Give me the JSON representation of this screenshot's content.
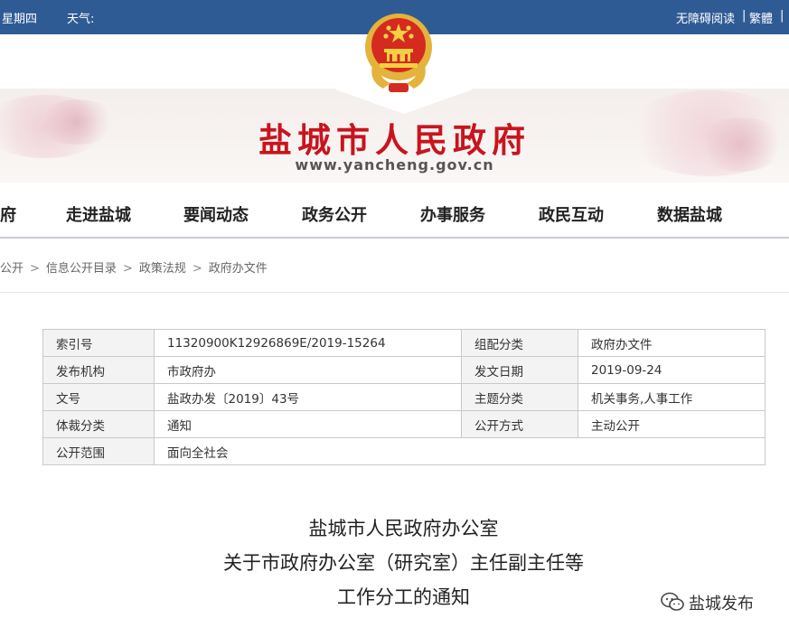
{
  "topbar": {
    "weekday": "星期四",
    "weather": "天气:",
    "accessibility": "无障碍阅读",
    "separator": "|",
    "traditional": "繁體"
  },
  "header": {
    "site_title": "盐城市人民政府",
    "url": "www.yancheng.gov.cn",
    "emblem_icon": "national-emblem-icon"
  },
  "nav": {
    "items": [
      "府",
      "走进盐城",
      "要闻动态",
      "政务公开",
      "办事服务",
      "政民互动",
      "数据盐城"
    ]
  },
  "breadcrumb": {
    "items": [
      "公开",
      "信息公开目录",
      "政策法规",
      "政府办文件"
    ],
    "separator": ">"
  },
  "meta_table": {
    "rows": [
      [
        "索引号",
        "11320900K12926869E/2019-15264",
        "组配分类",
        "政府办文件"
      ],
      [
        "发布机构",
        "市政府办",
        "发文日期",
        "2019-09-24"
      ],
      [
        "文号",
        "盐政办发〔2019〕43号",
        "主题分类",
        "机关事务,人事工作"
      ],
      [
        "体裁分类",
        "通知",
        "公开方式",
        "主动公开"
      ],
      [
        "公开范围",
        "面向全社会"
      ]
    ]
  },
  "document": {
    "title_lines": [
      "盐城市人民政府办公室",
      "关于市政府办公室（研究室）主任副主任等",
      "工作分工的通知"
    ]
  },
  "watermark": {
    "text": "盐城发布",
    "icon": "wechat-icon"
  },
  "colors": {
    "topbar": "#2f5b95",
    "title_red": "#c8141e",
    "emblem_gold": "#e3b33b"
  }
}
